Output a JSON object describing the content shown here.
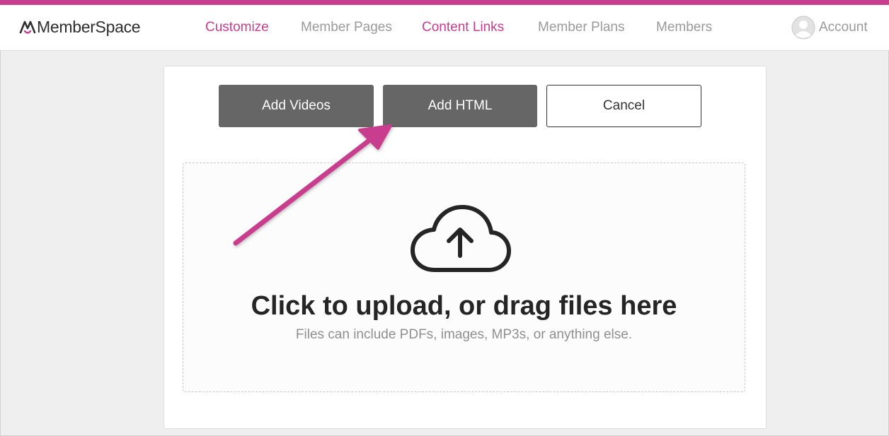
{
  "app": {
    "logo_text": "MemberSpace"
  },
  "colors": {
    "accent": "#c83d8e",
    "button_dark": "#666666",
    "nav_gray": "#9a9a9a"
  },
  "nav": {
    "items": [
      {
        "label": "Customize",
        "active": true
      },
      {
        "label": "Member Pages",
        "active": false
      },
      {
        "label": "Content Links",
        "active": true
      },
      {
        "label": "Member Plans",
        "active": false
      },
      {
        "label": "Members",
        "active": false
      }
    ],
    "account_label": "Account"
  },
  "actions": {
    "add_videos": "Add Videos",
    "add_html": "Add HTML",
    "cancel": "Cancel"
  },
  "upload": {
    "icon": "cloud-upload-icon",
    "title": "Click to upload, or drag files here",
    "subtitle": "Files can include PDFs, images, MP3s, or anything else."
  },
  "annotation": {
    "icon": "pointer-arrow",
    "points_to": "Add HTML"
  }
}
